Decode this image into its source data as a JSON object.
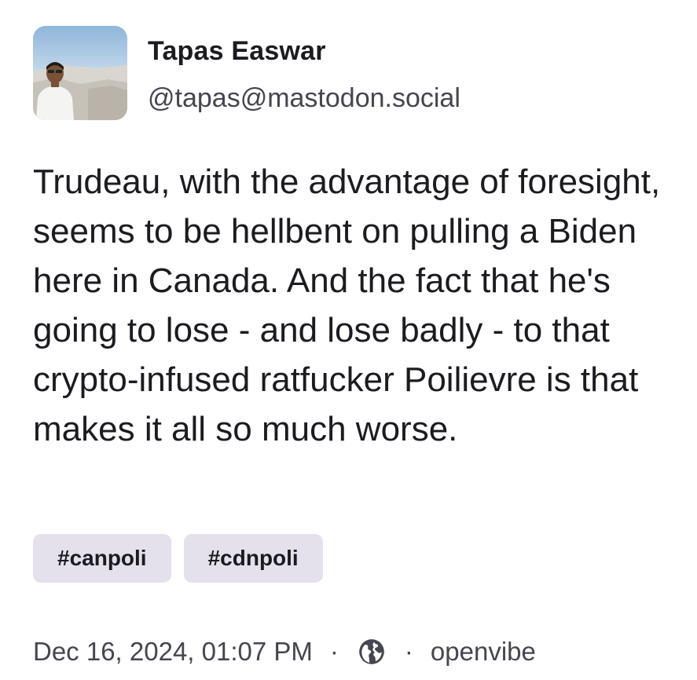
{
  "author": {
    "display_name": "Tapas Easwar",
    "handle": "@tapas@mastodon.social"
  },
  "post": {
    "text": "Trudeau, with the advantage of foresight, seems to be hellbent on pulling a Biden here in Canada. And the fact that he's going to lose - and lose badly - to that crypto-infused ratfucker Poilievre is that makes it all so much worse.",
    "tags": [
      {
        "label": "#canpoli"
      },
      {
        "label": "#cdnpoli"
      }
    ]
  },
  "meta": {
    "timestamp": "Dec 16, 2024, 01:07 PM",
    "separator": "·",
    "visibility_icon": "globe-icon",
    "client": "openvibe"
  },
  "colors": {
    "text": "#1b1b20",
    "secondary_text": "#45454f",
    "tag_background": "#e4e1ec"
  }
}
